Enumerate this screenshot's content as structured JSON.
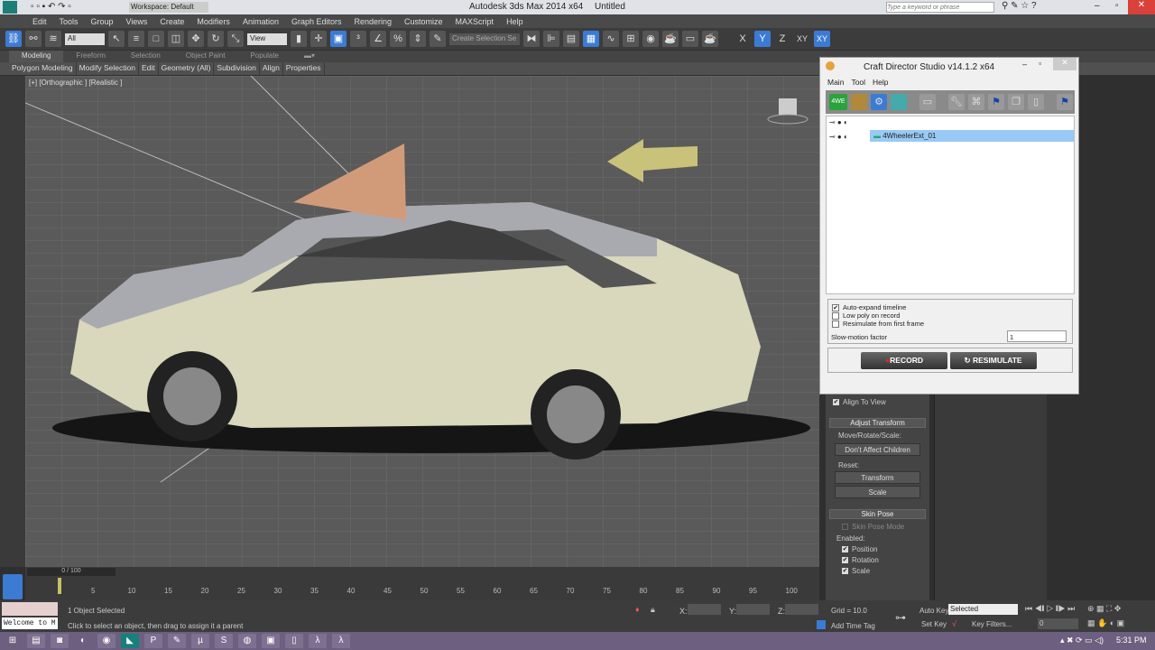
{
  "title": {
    "workspace": "Workspace: Default",
    "app": "Autodesk 3ds Max  2014 x64",
    "doc": "Untitled",
    "search_placeholder": "Type a keyword or phrase"
  },
  "menu": [
    "Edit",
    "Tools",
    "Group",
    "Views",
    "Create",
    "Modifiers",
    "Animation",
    "Graph Editors",
    "Rendering",
    "Customize",
    "MAXScript",
    "Help"
  ],
  "toolbar": {
    "filter": "All",
    "refcoord": "View",
    "selset": "Create Selection Se",
    "axes": [
      "X",
      "Y",
      "Z",
      "XY",
      "XY"
    ]
  },
  "ribbon_tabs": [
    "Modeling",
    "Freeform",
    "Selection",
    "Object Paint",
    "Populate"
  ],
  "ribbon_items": [
    "Polygon Modeling",
    "Modify Selection",
    "Edit",
    "Geometry (All)",
    "Subdivision",
    "Align",
    "Properties"
  ],
  "viewport": {
    "label": "[+] [Orthographic ] [Realistic ]"
  },
  "timeline": {
    "frame": "0 / 100",
    "ticks": [
      "5",
      "10",
      "15",
      "20",
      "25",
      "30",
      "35",
      "40",
      "45",
      "50",
      "55",
      "60",
      "65",
      "70",
      "75",
      "80",
      "85",
      "90",
      "95",
      "100"
    ]
  },
  "status": {
    "welcome": "Welcome to M",
    "selected": "1 Object Selected",
    "prompt": "Click to select an object, then drag to assign it a parent",
    "x_label": "X:",
    "y_label": "Y:",
    "z_label": "Z:",
    "grid": "Grid = 10.0",
    "add_time_tag": "Add Time Tag",
    "auto_key": "Auto Key",
    "set_key": "Set Key",
    "key_mode": "Selected",
    "key_filters": "Key Filters...",
    "frame_value": "0"
  },
  "craft": {
    "title": "Craft Director Studio v14.1.2 x64",
    "menu": [
      "Main",
      "Tool",
      "Help"
    ],
    "tool_badge": "4WE",
    "item": "4WheelerExt_01",
    "options": [
      {
        "label": "Auto-expand timeline",
        "checked": true
      },
      {
        "label": "Low poly on record",
        "checked": false
      },
      {
        "label": "Resimulate from first frame",
        "checked": false
      }
    ],
    "slowmo_label": "Slow-motion factor",
    "slowmo_value": "1",
    "record": "RECORD",
    "resimulate": "RESIMULATE"
  },
  "cmdpanel": {
    "align_to_view": "Align To View",
    "adjust_transform": "Adjust Transform",
    "move_rotate_scale": "Move/Rotate/Scale:",
    "dont_affect": "Don't Affect Children",
    "reset": "Reset:",
    "transform": "Transform",
    "scale_btn": "Scale",
    "skin_pose": "Skin Pose",
    "skin_pose_mode": "Skin Pose Mode",
    "enabled": "Enabled:",
    "position": "Position",
    "rotation": "Rotation",
    "scale": "Scale"
  },
  "clock": "5:31 PM"
}
